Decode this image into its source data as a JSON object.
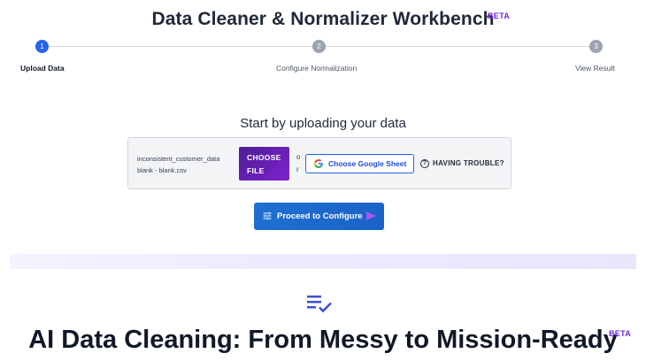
{
  "header": {
    "title": "Data Cleaner & Normalizer Workbench",
    "badge": "BETA"
  },
  "stepper": {
    "steps": [
      {
        "number": "1",
        "label": "Upload Data",
        "state": "active"
      },
      {
        "number": "2",
        "label": "Configure Normalization",
        "state": "inactive"
      },
      {
        "number": "3",
        "label": "View Result",
        "state": "inactive"
      }
    ]
  },
  "upload": {
    "heading": "Start by uploading your data",
    "file_name_line1": "inconsistent_customer_data",
    "file_name_line2": "blank - blank.csv",
    "choose_file_line1": "CHOOSE",
    "choose_file_line2": "FILE",
    "or_line1": "o",
    "or_line2": "r",
    "google_sheet_label": "Choose Google Sheet",
    "help_label": "HAVING TROUBLE?",
    "help_icon_glyph": "?"
  },
  "actions": {
    "proceed_label": "Proceed to Configure"
  },
  "hero": {
    "title": "AI Data Cleaning: From Messy to Mission-Ready",
    "badge": "BETA"
  },
  "colors": {
    "accent_blue": "#2563eb",
    "accent_purple": "#6d28d9",
    "step_inactive": "#9ca3af"
  },
  "icons": {
    "google": "google-g-icon",
    "help": "help-circle-icon",
    "tune": "tune-sliders-icon",
    "arrow": "arrow-right-icon",
    "list_check": "list-check-icon"
  }
}
